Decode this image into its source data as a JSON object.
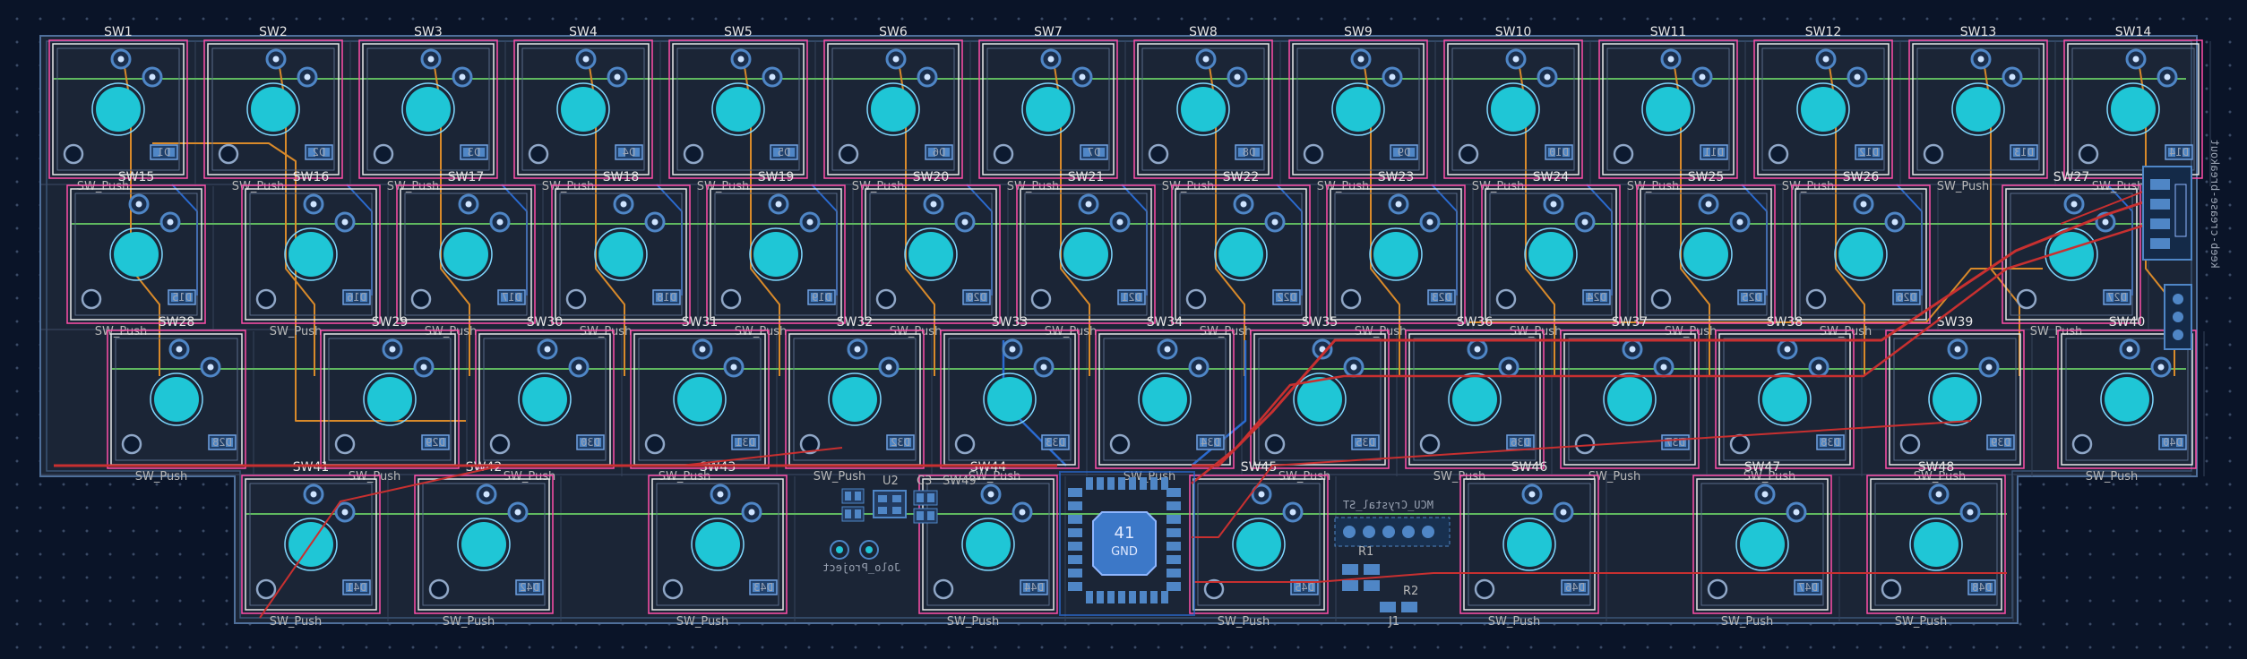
{
  "board": {
    "rows": [
      {
        "keys": [
          "SW1",
          "SW2",
          "SW3",
          "SW4",
          "SW5",
          "SW6",
          "SW7",
          "SW8",
          "SW9",
          "SW10",
          "SW11",
          "SW12",
          "SW13",
          "SW14"
        ],
        "diodes": [
          "D1",
          "D2",
          "D3",
          "D4",
          "D5",
          "D6",
          "D7",
          "D8",
          "D9",
          "D10",
          "D11",
          "D12",
          "D13",
          "D14"
        ]
      },
      {
        "keys": [
          "SW15",
          "SW16",
          "SW17",
          "SW18",
          "SW19",
          "SW20",
          "SW21",
          "SW22",
          "SW23",
          "SW24",
          "SW25",
          "SW26",
          "SW27"
        ],
        "diodes": [
          "D15",
          "D16",
          "D17",
          "D18",
          "D19",
          "D20",
          "D21",
          "D22",
          "D23",
          "D24",
          "D25",
          "D26",
          "D27"
        ]
      },
      {
        "keys": [
          "SW28",
          "SW29",
          "SW30",
          "SW31",
          "SW32",
          "SW33",
          "SW34",
          "SW35",
          "SW36",
          "SW37",
          "SW38",
          "SW39",
          "SW40"
        ],
        "diodes": [
          "D28",
          "D29",
          "D30",
          "D31",
          "D32",
          "D33",
          "D34",
          "D35",
          "D36",
          "D37",
          "D38",
          "D39",
          "D40"
        ]
      },
      {
        "keys": [
          "SW41",
          "SW42",
          "SW43",
          "SW44",
          "SW45",
          "SW46",
          "SW47",
          "SW48"
        ],
        "diodes": [
          "D41",
          "D42",
          "D43",
          "D44",
          "D45",
          "D46",
          "D47",
          "D48"
        ]
      }
    ],
    "key_value": "SW_Push",
    "mcu": {
      "pin": "41",
      "net": "GND"
    },
    "small_labels": [
      "U2",
      "C3",
      "C4",
      "R1",
      "R2",
      "SW49",
      "J1"
    ],
    "mirrored_texts": [
      "keeb-crease-breakout",
      "MCU_Crystal_ST",
      "Jolo_Project"
    ],
    "colors": {
      "background": "#0a1428",
      "edge_cuts": "#d6d600",
      "keycap_outline": "#e8e8e8",
      "courtyard": "#ff4fa8",
      "front_copper": "#c83030",
      "back_copper": "#2a6ad0",
      "inner_trace_orange": "#d98a2a",
      "inner_trace_green": "#5fb85f",
      "pad": "#1fc6d6",
      "smd_pad": "#4f86c6"
    }
  }
}
